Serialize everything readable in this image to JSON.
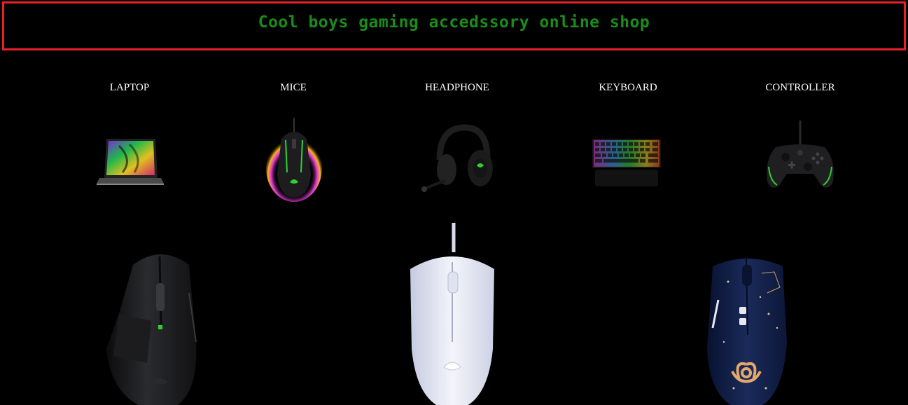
{
  "header": {
    "title": "Cool boys gaming accedssory online shop"
  },
  "categories": [
    {
      "label": "LAPTOP",
      "icon": "laptop-image"
    },
    {
      "label": "MICE",
      "icon": "mouse-image"
    },
    {
      "label": "HEADPHONE",
      "icon": "headphone-image"
    },
    {
      "label": "KEYBOARD",
      "icon": "keyboard-image"
    },
    {
      "label": "CONTROLLER",
      "icon": "controller-image"
    }
  ],
  "products": [
    {
      "name": "black-gaming-mouse",
      "color": "#1c1c1e"
    },
    {
      "name": "white-gaming-mouse",
      "color": "#e6e9f4"
    },
    {
      "name": "navy-constellation-mouse",
      "color": "#0f1c3d"
    }
  ],
  "colors": {
    "background": "#000000",
    "header_border": "#e8202a",
    "header_text": "#1a8c1a",
    "accent_green": "#44d62c"
  }
}
